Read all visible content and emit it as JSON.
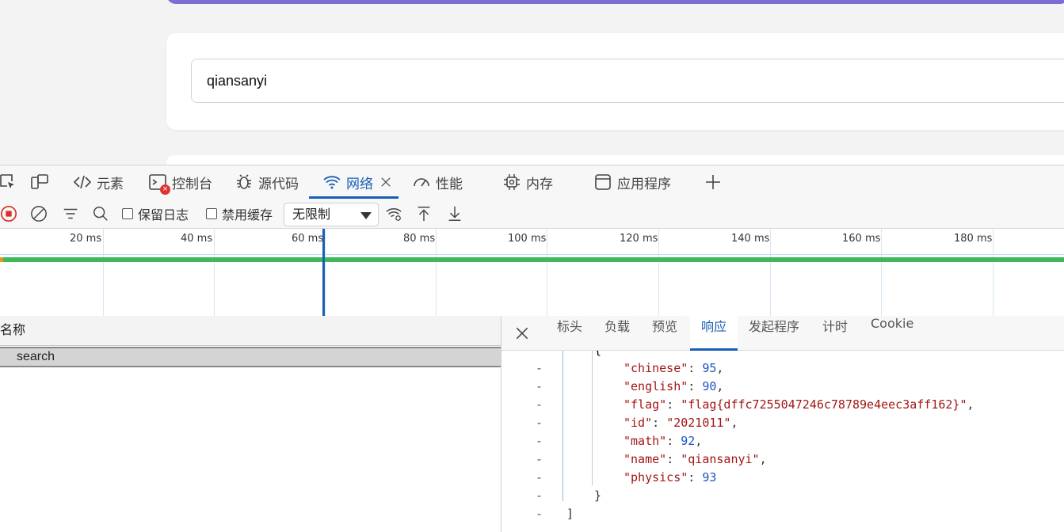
{
  "page": {
    "search_value": "qiansanyi"
  },
  "devtools": {
    "tabs": [
      {
        "label": "元素"
      },
      {
        "label": "控制台"
      },
      {
        "label": "源代码"
      },
      {
        "label": "网络"
      },
      {
        "label": "性能"
      },
      {
        "label": "内存"
      },
      {
        "label": "应用程序"
      }
    ],
    "console_error_badge": "×",
    "toolbar": {
      "preserve_log_label": "保留日志",
      "disable_cache_label": "禁用缓存",
      "throttle_value": "无限制"
    },
    "timeline": {
      "ticks": [
        "20 ms",
        "40 ms",
        "60 ms",
        "80 ms",
        "100 ms",
        "120 ms",
        "140 ms",
        "160 ms",
        "180 ms"
      ]
    },
    "request_list": {
      "column_name": "名称",
      "rows": [
        "search"
      ]
    },
    "detail": {
      "tabs": [
        "标头",
        "负载",
        "预览",
        "响应",
        "发起程序",
        "计时",
        "Cookie"
      ],
      "active_tab": "响应",
      "response": {
        "open_brace": "{",
        "fields": [
          {
            "key": "\"chinese\"",
            "value": "95",
            "type": "number",
            "comma": ","
          },
          {
            "key": "\"english\"",
            "value": "90",
            "type": "number",
            "comma": ","
          },
          {
            "key": "\"flag\"",
            "value": "\"flag{dffc7255047246c78789e4eec3aff162}\"",
            "type": "string",
            "comma": ","
          },
          {
            "key": "\"id\"",
            "value": "\"2021011\"",
            "type": "string",
            "comma": ","
          },
          {
            "key": "\"math\"",
            "value": "92",
            "type": "number",
            "comma": ","
          },
          {
            "key": "\"name\"",
            "value": "\"qiansanyi\"",
            "type": "string",
            "comma": ","
          },
          {
            "key": "\"physics\"",
            "value": "93",
            "type": "number",
            "comma": ""
          }
        ],
        "close_brace": "}",
        "close_bracket": "]",
        "gutter_marker": "-"
      }
    }
  }
}
